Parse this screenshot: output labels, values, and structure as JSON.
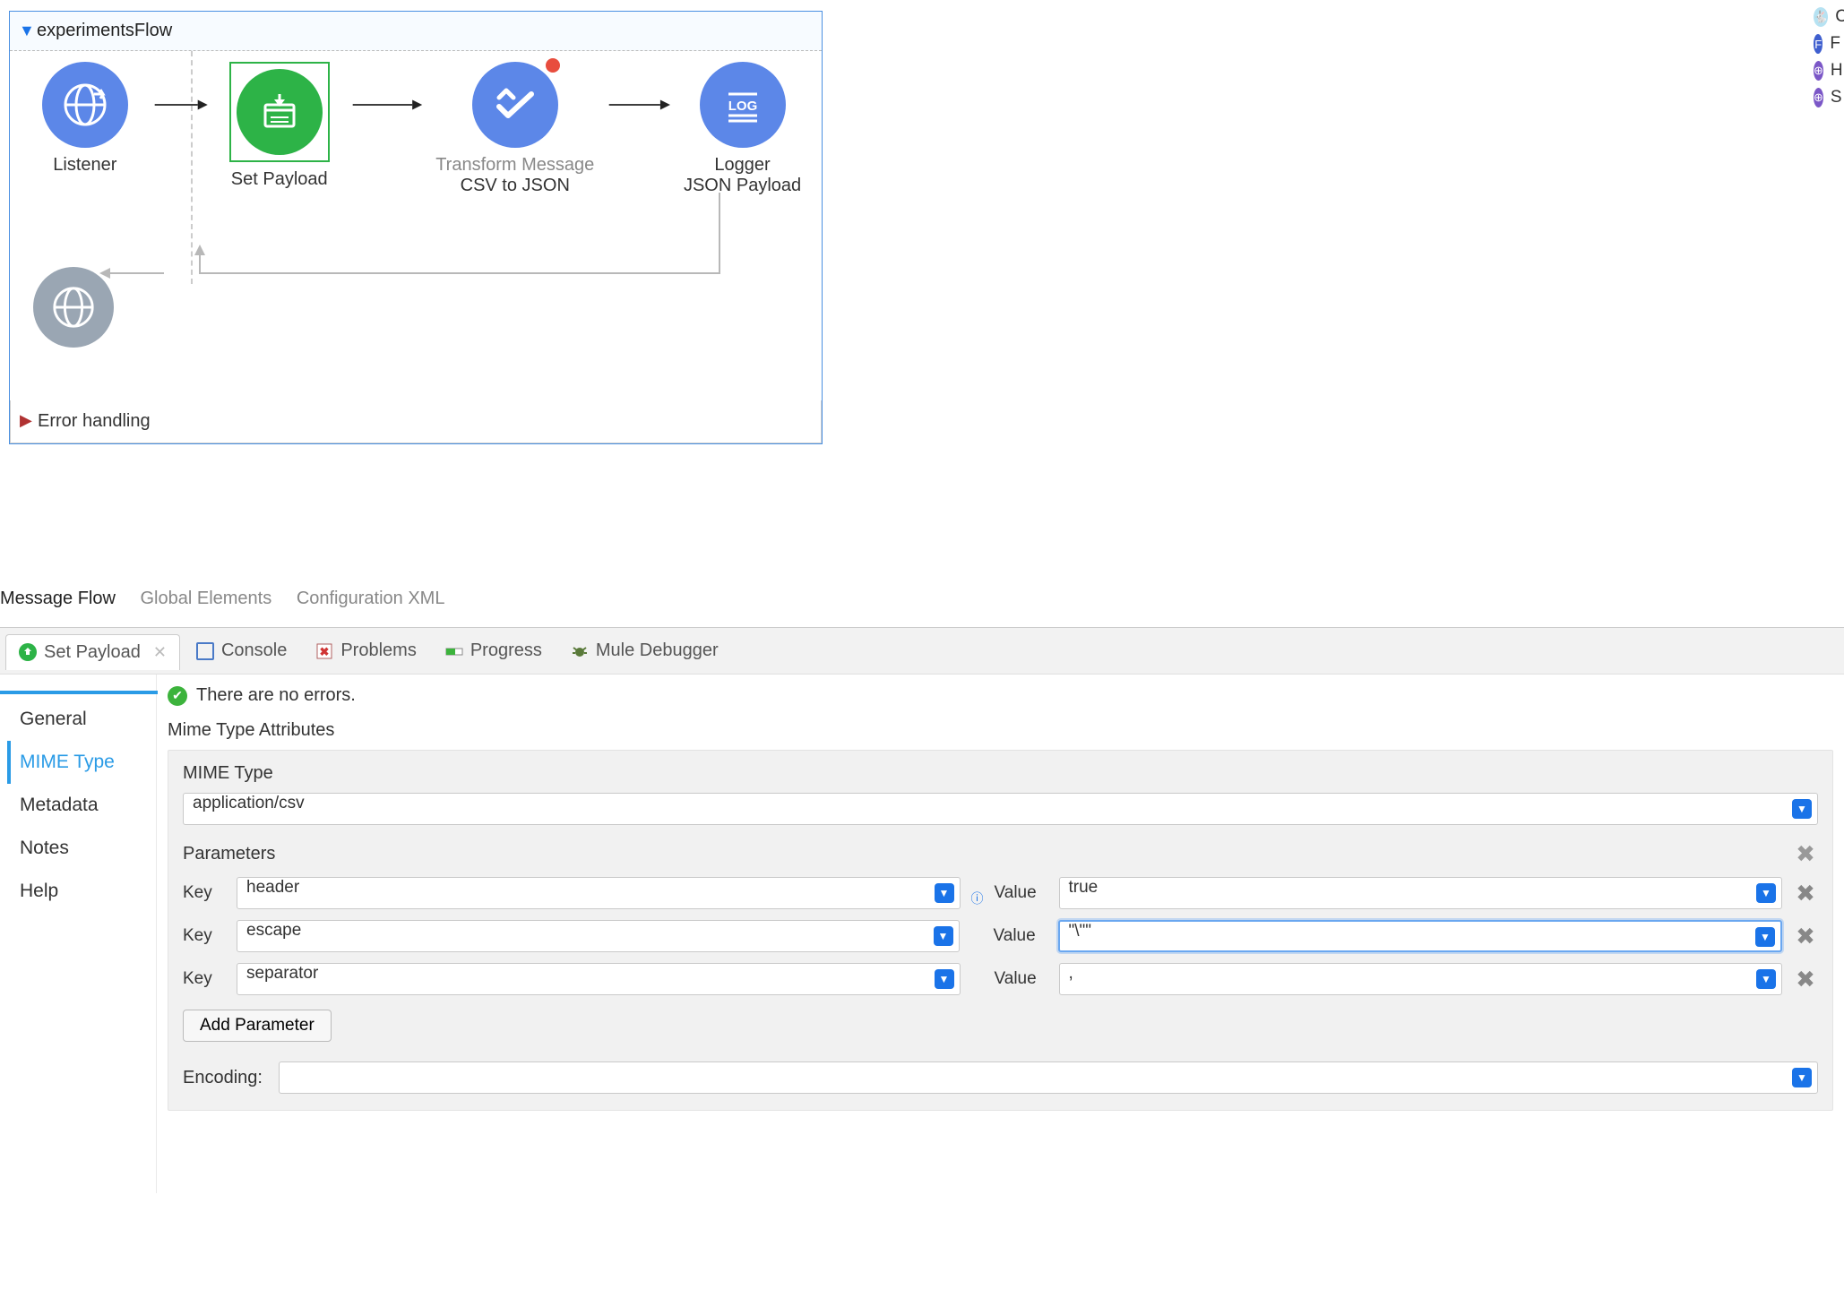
{
  "flow": {
    "title": "experimentsFlow",
    "nodes": {
      "listener": {
        "label": "Listener"
      },
      "setPayload": {
        "label": "Set Payload"
      },
      "transform": {
        "label1": "Transform Message",
        "label2": "CSV to JSON"
      },
      "logger": {
        "label1": "Logger",
        "label2": "JSON Payload"
      }
    },
    "error_section": "Error handling"
  },
  "bottom_tabs": {
    "items": [
      "Message Flow",
      "Global Elements",
      "Configuration XML"
    ],
    "activeIndex": 0
  },
  "panel_tabs": {
    "items": [
      "Set Payload",
      "Console",
      "Problems",
      "Progress",
      "Mule Debugger"
    ],
    "activeIndex": 0
  },
  "sidenav": {
    "items": [
      "General",
      "MIME Type",
      "Metadata",
      "Notes",
      "Help"
    ],
    "activeIndex": 1
  },
  "config": {
    "status": "There are no errors.",
    "section_title": "Mime Type Attributes",
    "mime_label": "MIME Type",
    "mime_value": "application/csv",
    "params_label": "Parameters",
    "key_label": "Key",
    "value_label": "Value",
    "params": [
      {
        "key": "header",
        "value": "true"
      },
      {
        "key": "escape",
        "value": "\"\\\"\""
      },
      {
        "key": "separator",
        "value": ","
      }
    ],
    "add_btn": "Add Parameter",
    "encoding_label": "Encoding:",
    "encoding_value": ""
  },
  "right_rail": {
    "items": [
      "C",
      "F",
      "H",
      "S"
    ]
  }
}
